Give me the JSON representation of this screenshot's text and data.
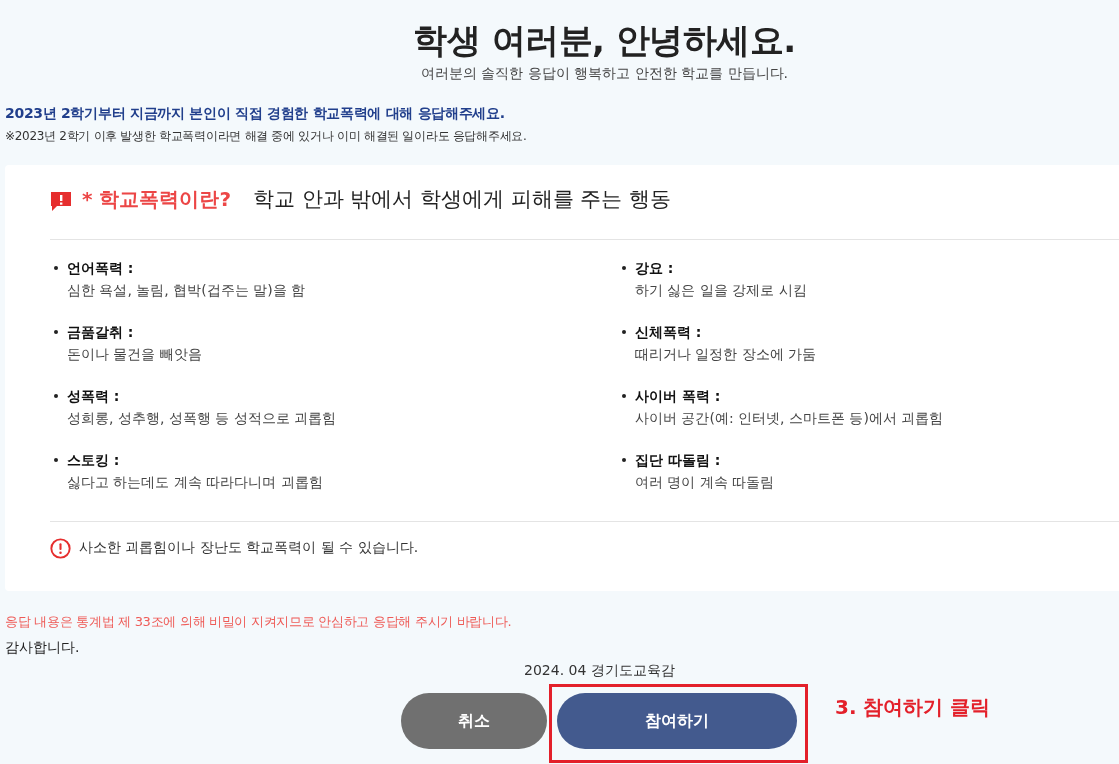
{
  "header": {
    "title": "학생 여러분, 안녕하세요.",
    "subtitle": "여러분의 솔직한 응답이 행복하고 안전한 학교를 만듭니다."
  },
  "intro": {
    "instruction": "2023년 2학기부터 지금까지 본인이 직접 경험한 학교폭력에 대해 응답해주세요.",
    "note": "※2023년 2학기 이후 발생한 학교폭력이라면 해결 중에 있거나 이미 해결된 일이라도 응답해주세요."
  },
  "definition_card": {
    "heading": "* 학교폭력이란?",
    "description": "학교 안과 밖에서 학생에게 피해를 주는 행동",
    "types": [
      {
        "term": "언어폭력 :",
        "explanation": "심한 욕설, 놀림, 협박(겁주는 말)을 함"
      },
      {
        "term": "강요 :",
        "explanation": "하기 싫은 일을 강제로 시킴"
      },
      {
        "term": "금품갈취 :",
        "explanation": "돈이나 물건을 빼앗음"
      },
      {
        "term": "신체폭력 :",
        "explanation": "때리거나 일정한 장소에 가둠"
      },
      {
        "term": "성폭력 :",
        "explanation": "성희롱, 성추행, 성폭행 등 성적으로 괴롭힘"
      },
      {
        "term": "사이버 폭력 :",
        "explanation": "사이버 공간(예: 인터넷, 스마트폰 등)에서 괴롭힘"
      },
      {
        "term": "스토킹 :",
        "explanation": "싫다고 하는데도 계속 따라다니며 괴롭힘"
      },
      {
        "term": "집단 따돌림 :",
        "explanation": "여러 명이 계속 따돌림"
      }
    ],
    "notice": "사소한 괴롭힘이나 장난도 학교폭력이 될 수 있습니다."
  },
  "footer": {
    "privacy": "응답 내용은 통계법 제 33조에 의해 비밀이 지켜지므로 안심하고 응답해 주시기 바랍니다.",
    "thanks": "감사합니다.",
    "signature": "2024. 04 경기도교육감"
  },
  "buttons": [
    {
      "label": "취소",
      "kind": "secondary",
      "highlighted": false
    },
    {
      "label": "참여하기",
      "kind": "primary",
      "highlighted": true
    }
  ],
  "annotation": {
    "label": "3. 참여하기 클릭"
  }
}
